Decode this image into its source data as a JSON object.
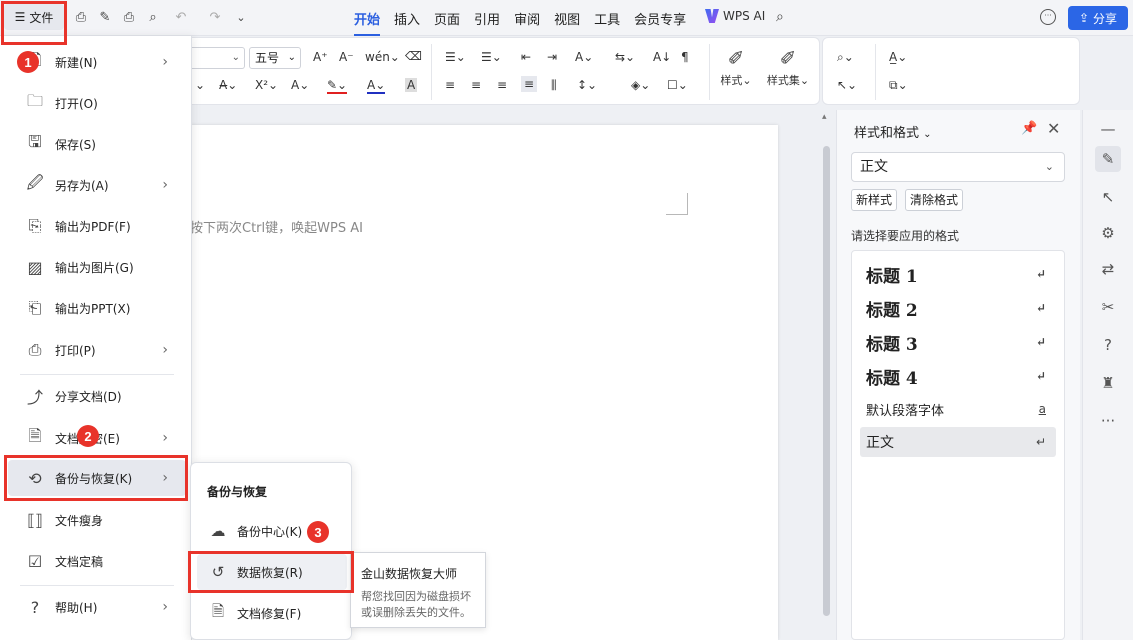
{
  "topbar": {
    "file_label": "文件",
    "tabs": [
      "开始",
      "插入",
      "页面",
      "引用",
      "审阅",
      "视图",
      "工具",
      "会员专享"
    ],
    "wps_ai": "WPS AI",
    "share": "分享"
  },
  "ribbon": {
    "font_size": "五号",
    "style_label": "样式",
    "styleset_label": "样式集"
  },
  "document": {
    "hint": "按下两次Ctrl键，唤起WPS AI"
  },
  "file_menu": {
    "items": [
      {
        "label": "新建(N)",
        "icon": "new-file-icon"
      },
      {
        "label": "打开(O)",
        "icon": "folder-icon"
      },
      {
        "label": "保存(S)",
        "icon": "save-icon"
      },
      {
        "label": "另存为(A)",
        "icon": "save-as-icon"
      },
      {
        "label": "输出为PDF(F)",
        "icon": "pdf-icon"
      },
      {
        "label": "输出为图片(G)",
        "icon": "image-icon"
      },
      {
        "label": "输出为PPT(X)",
        "icon": "ppt-icon"
      },
      {
        "label": "打印(P)",
        "icon": "printer-icon"
      },
      {
        "label": "分享文档(D)",
        "icon": "share-icon"
      },
      {
        "label": "文档加密(E)",
        "icon": "lock-file-icon"
      },
      {
        "label": "备份与恢复(K)",
        "icon": "backup-icon"
      },
      {
        "label": "文件瘦身",
        "icon": "slim-icon"
      },
      {
        "label": "文档定稿",
        "icon": "finalize-icon"
      },
      {
        "label": "帮助(H)",
        "icon": "help-icon"
      }
    ]
  },
  "submenu": {
    "title": "备份与恢复",
    "items": [
      {
        "label": "备份中心(K)"
      },
      {
        "label": "数据恢复(R)"
      },
      {
        "label": "文档修复(F)"
      }
    ]
  },
  "tooltip": {
    "title": "金山数据恢复大师",
    "desc": "帮您找回因为磁盘损坏或误删除丢失的文件。"
  },
  "styles_panel": {
    "title": "样式和格式",
    "current": "正文",
    "new_style": "新样式",
    "clear_format": "清除格式",
    "apply_label": "请选择要应用的格式",
    "styles": [
      {
        "label": "标题  1",
        "mark": "↵"
      },
      {
        "label": "标题  2",
        "mark": "↵"
      },
      {
        "label": "标题  3",
        "mark": "↵"
      },
      {
        "label": "标题 4",
        "mark": "↵"
      },
      {
        "label": "默认段落字体",
        "mark": "a"
      },
      {
        "label": "正文",
        "mark": "↵"
      }
    ]
  },
  "annotations": [
    "1",
    "2",
    "3"
  ],
  "colors": {
    "accent": "#2b5fe0",
    "annotation_red": "#e8332a"
  }
}
